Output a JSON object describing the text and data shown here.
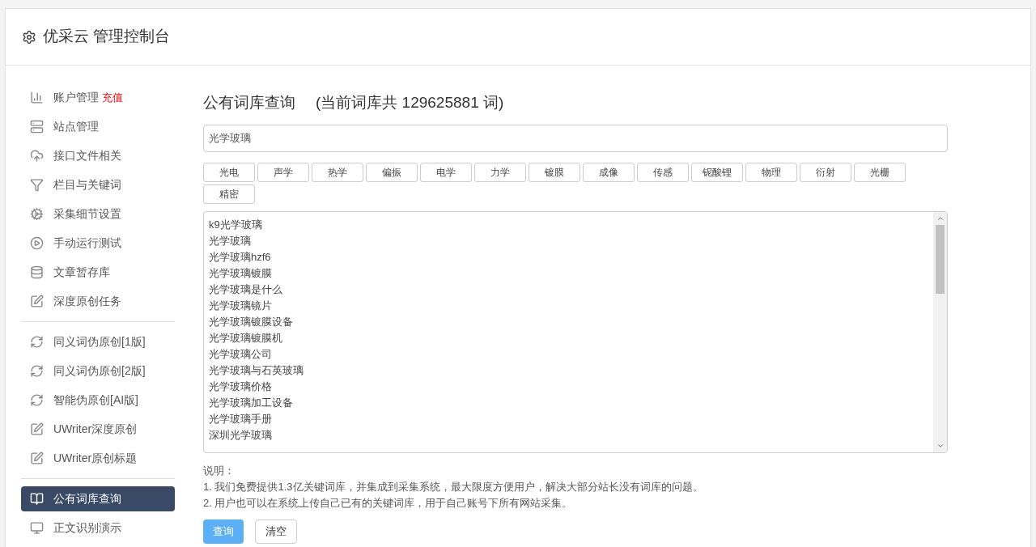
{
  "header": {
    "title": "优采云 管理控制台"
  },
  "sidebar": {
    "groups": [
      {
        "items": [
          {
            "label": "账户管理",
            "badge": "充值",
            "selected": false
          },
          {
            "label": "站点管理",
            "selected": false
          },
          {
            "label": "接口文件相关",
            "selected": false
          },
          {
            "label": "栏目与关键词",
            "selected": false
          },
          {
            "label": "采集细节设置",
            "selected": false
          },
          {
            "label": "手动运行测试",
            "selected": false
          },
          {
            "label": "文章暂存库",
            "selected": false
          },
          {
            "label": "深度原创任务",
            "selected": false
          }
        ]
      },
      {
        "items": [
          {
            "label": "同义词伪原创[1版]",
            "selected": false
          },
          {
            "label": "同义词伪原创[2版]",
            "selected": false
          },
          {
            "label": "智能伪原创[AI版]",
            "selected": false
          },
          {
            "label": "UWriter深度原创",
            "selected": false
          },
          {
            "label": "UWriter原创标题",
            "selected": false
          }
        ]
      },
      {
        "items": [
          {
            "label": "公有词库查询",
            "selected": true
          },
          {
            "label": "正文识别演示",
            "selected": false
          }
        ]
      }
    ]
  },
  "main": {
    "title": "公有词库查询",
    "subtitle": "(当前词库共 129625881 词)",
    "search": {
      "value": "光学玻璃"
    },
    "tags": [
      "光电",
      "声学",
      "热学",
      "偏振",
      "电学",
      "力学",
      "镀膜",
      "成像",
      "传感",
      "铌酸锂",
      "物理",
      "衍射",
      "光栅",
      "精密"
    ],
    "results": [
      "k9光学玻璃",
      "光学玻璃",
      "光学玻璃hzf6",
      "光学玻璃镀膜",
      "光学玻璃是什么",
      "光学玻璃镜片",
      "光学玻璃镀膜设备",
      "光学玻璃镀膜机",
      "光学玻璃公司",
      "光学玻璃与石英玻璃",
      "光学玻璃价格",
      "光学玻璃加工设备",
      "光学玻璃手册",
      "深圳光学玻璃"
    ],
    "notes_title": "说明：",
    "notes": [
      "1. 我们免费提供1.3亿关键词库，并集成到采集系统，最大限度方便用户，解决大部分站长没有词库的问题。",
      "2. 用户也可以在系统上传自己已有的关键词库，用于自己账号下所有网站采集。"
    ],
    "buttons": [
      {
        "label": "查询",
        "kind": "primary"
      },
      {
        "label": "清空",
        "kind": "default"
      }
    ]
  }
}
